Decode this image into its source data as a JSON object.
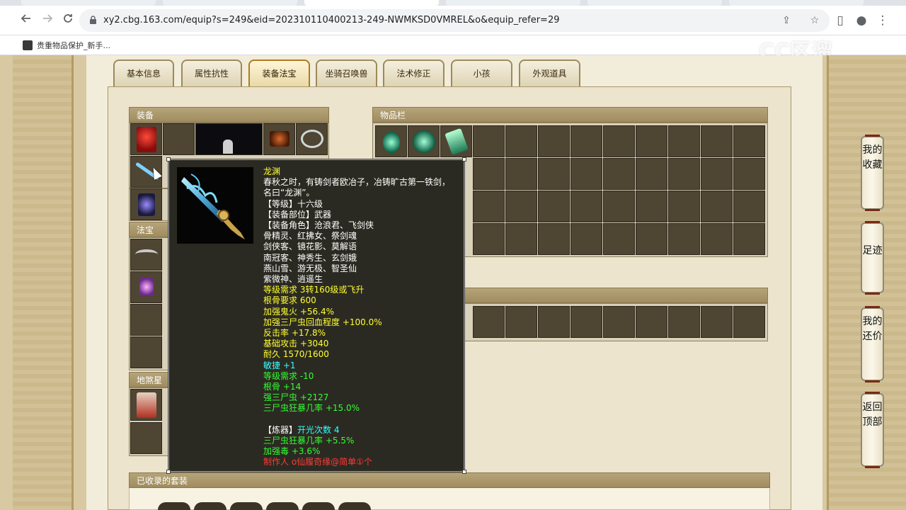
{
  "browser": {
    "url": "xy2.cbg.163.com/equip?s=249&eid=202310110400213-249-NWMKSD0VMREL&o&equip_refer=29",
    "bookmark_label": "贵重物品保护_新手..."
  },
  "tabs": [
    {
      "label": "基本信息",
      "active": false
    },
    {
      "label": "属性抗性",
      "active": false
    },
    {
      "label": "装备法宝",
      "active": true
    },
    {
      "label": "坐骑召唤兽",
      "active": false
    },
    {
      "label": "法术修正",
      "active": false
    },
    {
      "label": "小孩",
      "active": false
    },
    {
      "label": "外观道具",
      "active": false
    }
  ],
  "sections": {
    "equipment": "装备",
    "fabao": "法宝",
    "disha": "地煞星",
    "inventory": "物品栏",
    "suits": "已收录的套装"
  },
  "tooltip": {
    "name": "龙渊",
    "description": [
      "春秋之时，有铸剑者欧冶子，冶铸旷古第一铁剑，",
      "名曰“龙渊”。"
    ],
    "basic": [
      "【等级】十六级",
      "【装备部位】武器",
      "【装备角色】沧浪君、飞剑侠",
      "骨精灵、红拂女、祭剑魂",
      "剑侠客、镜花影、莫解语",
      "南冠客、神秀生、玄剑娥",
      "燕山雪、游无极、智圣仙",
      "紫微神、逍遥生"
    ],
    "requirements": [
      "等级需求 3转160级或飞升",
      "根骨要求 600",
      "加强鬼火 +56.4%",
      "加强三尸虫回血程度 +100.0%",
      "反击率 +17.8%",
      "基础攻击 +3040",
      "耐久 1570/1600"
    ],
    "cyan_attr": "敏捷 +1",
    "green_attrs": [
      "等级需求 -10",
      "根骨 +14",
      "强三尸虫 +2127",
      "三尸虫狂暴几率 +15.0%"
    ],
    "refine_label": "【炼器】",
    "refine_value": "开光次数 4",
    "refine_attrs": [
      "三尸虫狂暴几率 +5.5%",
      "加强毒 +3.6%"
    ],
    "maker": "制作人 o仙履奇缘@简单①个"
  },
  "side_buttons": [
    {
      "label": "我的收藏"
    },
    {
      "label": "足迹"
    },
    {
      "label": "我的还价"
    },
    {
      "label": "返回顶部"
    }
  ],
  "watermark": "CC区溜",
  "colors": {
    "section_header": "#a8966a",
    "slot_bg": "#4f4533",
    "tooltip_bg": "#2b2a22",
    "text_yellow": "#ffff33",
    "text_green": "#33ff33",
    "text_cyan": "#33ffff",
    "text_red": "#ff3a3a"
  }
}
